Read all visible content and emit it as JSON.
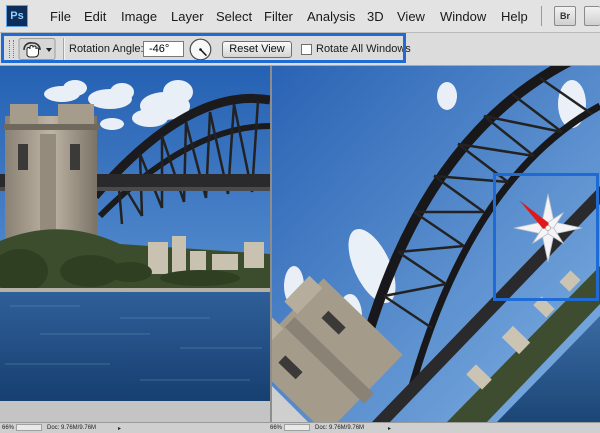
{
  "menu": {
    "logo": "Ps",
    "items": [
      "File",
      "Edit",
      "Image",
      "Layer",
      "Select",
      "Filter",
      "Analysis",
      "3D",
      "View",
      "Window",
      "Help"
    ],
    "bridge_button": "Br"
  },
  "options_bar": {
    "tool_icon": "rotate-view-hand-icon",
    "rotation_label": "Rotation Angle:",
    "rotation_value": "-46°",
    "rotation_degrees": -46,
    "reset_label": "Reset View",
    "rotate_all_label": "Rotate All Windows",
    "rotate_all_checked": false
  },
  "documents": [
    {
      "name": "original-photo",
      "subject": "harbour bridge pylon and arch"
    },
    {
      "name": "rotated-view",
      "rotation_degrees": -46,
      "compass_icon": "compass-rose-icon"
    }
  ],
  "status": {
    "left_zoom": "66%",
    "left_doc": "Doc: 9.76M/9.76M",
    "right_zoom": "66%",
    "right_doc": "Doc: 9.76M/9.76M"
  },
  "colors": {
    "highlight": "#1f6bd6",
    "compass_needle": "#e01818",
    "sky": "#2b66b3",
    "water": "#1f4e86"
  }
}
